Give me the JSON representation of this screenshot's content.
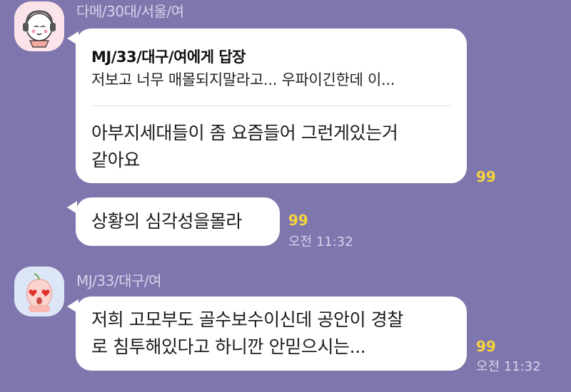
{
  "messages": [
    {
      "sender": "다메/30대/서울/여",
      "avatar": "headphones-girl-icon",
      "reply": {
        "to": "MJ/33/대구/여에게 답장",
        "preview": "저보고 너무 매몰되지말라고... 우파이긴한데 이..."
      },
      "text_line1": "아부지세대들이 좀 요즘들어 그런게있는거",
      "text_line2": "같아요",
      "unread": "99"
    },
    {
      "text": "상황의 심각성을몰라",
      "unread": "99",
      "time": "오전 11:32"
    },
    {
      "sender": "MJ/33/대구/여",
      "avatar": "peach-heart-eyes-icon",
      "text_line1": "저희 고모부도 골수보수이신데 공안이 경찰",
      "text_line2": "로 침투해있다고 하니깐 안믿으시는...",
      "unread": "99",
      "time": "오전 11:32"
    }
  ],
  "colors": {
    "background": "#7f76ad",
    "bubble": "#ffffff",
    "unread": "#f6d43c",
    "meta_text": "#d8d3ec"
  }
}
